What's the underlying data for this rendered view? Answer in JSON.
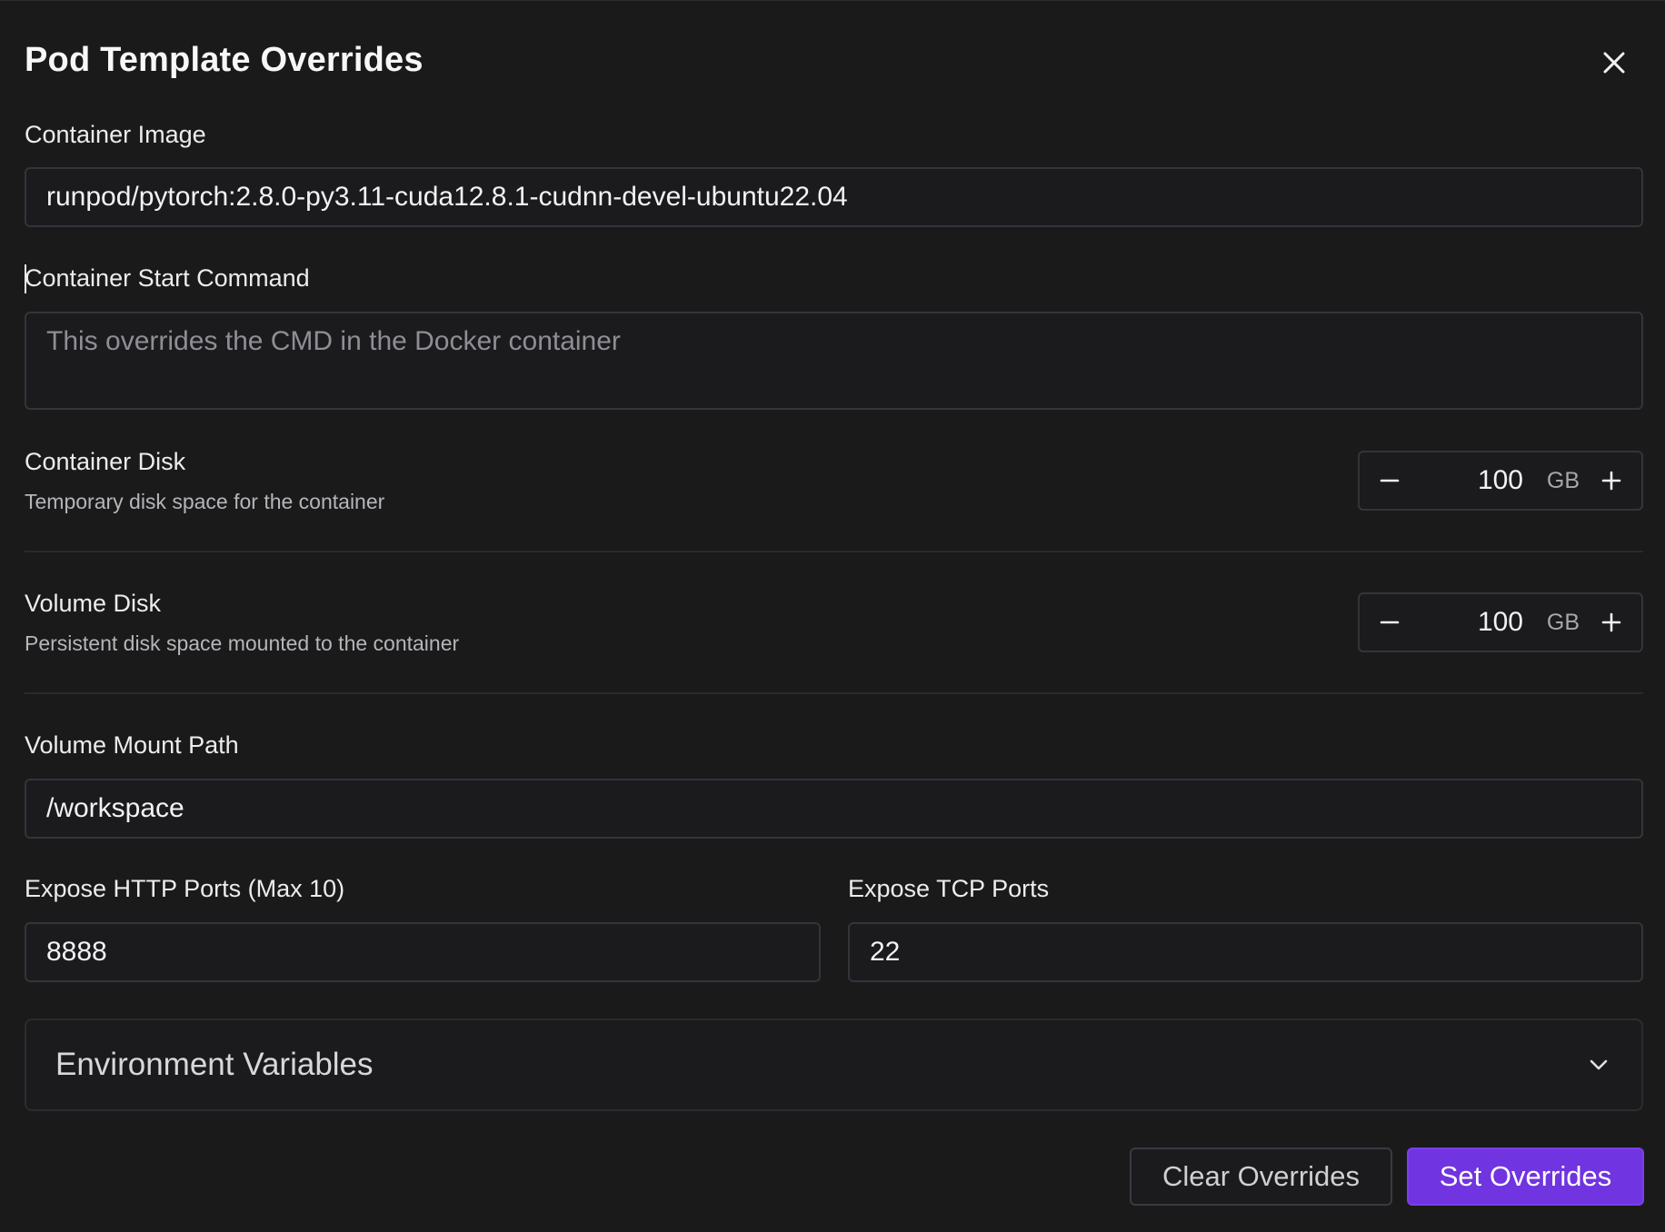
{
  "dialog": {
    "title": "Pod Template Overrides"
  },
  "container_image": {
    "label": "Container Image",
    "value": "runpod/pytorch:2.8.0-py3.11-cuda12.8.1-cudnn-devel-ubuntu22.04"
  },
  "start_command": {
    "label": "Container Start Command",
    "placeholder": "This overrides the CMD in the Docker container"
  },
  "container_disk": {
    "label": "Container Disk",
    "description": "Temporary disk space for the container",
    "value": "100",
    "unit": "GB"
  },
  "volume_disk": {
    "label": "Volume Disk",
    "description": "Persistent disk space mounted to the container",
    "value": "100",
    "unit": "GB"
  },
  "volume_mount": {
    "label": "Volume Mount Path",
    "value": "/workspace"
  },
  "http_ports": {
    "label": "Expose HTTP Ports (Max 10)",
    "value": "8888"
  },
  "tcp_ports": {
    "label": "Expose TCP Ports",
    "value": "22"
  },
  "env_vars": {
    "label": "Environment Variables"
  },
  "actions": {
    "clear_label": "Clear Overrides",
    "set_label": "Set Overrides"
  },
  "icons": {
    "close": "close-icon",
    "minus": "minus-icon",
    "plus": "plus-icon",
    "chevron": "chevron-down-icon"
  },
  "colors": {
    "background": "#1a1a1b",
    "accent": "#7034e0",
    "border": "#34343a"
  }
}
